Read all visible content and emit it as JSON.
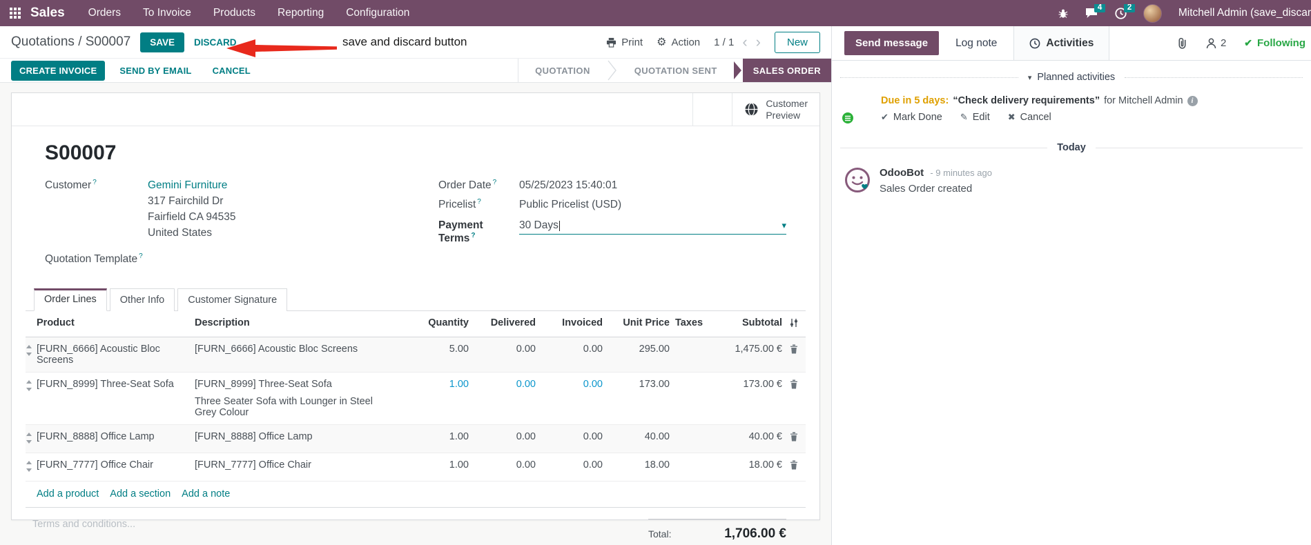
{
  "colors": {
    "navbar_purple": "#714B67",
    "primary_teal": "#017E84",
    "stage_active": "#714B67",
    "following_green": "#28a745",
    "annotation_red": "#e8291c",
    "edited_value_blue": "#0b96cc",
    "due_orange": "#dfa000",
    "badge_teal": "#0b8e93"
  },
  "icons": {
    "nav_left": "apps-grid",
    "nav_right": [
      "bug",
      "chat-bubble",
      "clock"
    ],
    "control_panel": [
      "printer",
      "gear",
      "chevron-left",
      "chevron-right"
    ],
    "sheet": [
      "globe",
      "drag-handle",
      "trash",
      "column-sliders",
      "dropdown-caret"
    ],
    "chatter": [
      "clock",
      "paperclip",
      "person",
      "check",
      "pencil",
      "x-mark",
      "info"
    ]
  },
  "nav": {
    "app_name": "Sales",
    "menus": [
      "Orders",
      "To Invoice",
      "Products",
      "Reporting",
      "Configuration"
    ],
    "message_badge": "4",
    "activity_badge": "2",
    "user_name": "Mitchell Admin (save_discar"
  },
  "control_panel": {
    "breadcrumb_parent": "Quotations",
    "breadcrumb_separator": "/",
    "breadcrumb_current": "S00007",
    "save_label": "SAVE",
    "discard_label": "DISCARD",
    "annotation_text": "save and discard button",
    "print_label": "Print",
    "action_label": "Action",
    "gear_glyph": "⚙",
    "pager": "1 / 1",
    "prev_glyph": "‹",
    "next_glyph": "›",
    "new_label": "New"
  },
  "statusbar": {
    "create_invoice": "CREATE INVOICE",
    "send_by_email": "SEND BY EMAIL",
    "cancel": "CANCEL",
    "stages": [
      {
        "label": "QUOTATION",
        "active": false
      },
      {
        "label": "QUOTATION SENT",
        "active": false
      },
      {
        "label": "SALES ORDER",
        "active": true
      }
    ]
  },
  "form": {
    "preview_line1": "Customer",
    "preview_line2": "Preview",
    "title": "S00007",
    "help_marker": "?",
    "customer": {
      "label": "Customer",
      "name": "Gemini Furniture",
      "address1": "317 Fairchild Dr",
      "address2": "Fairfield CA 94535",
      "address3": "United States"
    },
    "quotation_template_label": "Quotation Template",
    "order_date": {
      "label": "Order Date",
      "value": "05/25/2023 15:40:01"
    },
    "pricelist": {
      "label": "Pricelist",
      "value": "Public Pricelist (USD)"
    },
    "payment_terms": {
      "label": "Payment Terms",
      "value": "30 Days",
      "caret": "▾"
    },
    "tabs": [
      {
        "label": "Order Lines",
        "active": true
      },
      {
        "label": "Other Info",
        "active": false
      },
      {
        "label": "Customer Signature",
        "active": false
      }
    ],
    "order_lines": {
      "columns": [
        "Product",
        "Description",
        "Quantity",
        "Delivered",
        "Invoiced",
        "Unit Price",
        "Taxes",
        "Subtotal"
      ],
      "rows": [
        {
          "product": "[FURN_6666] Acoustic Bloc Screens",
          "description": "[FURN_6666] Acoustic Bloc Screens",
          "description_note": "",
          "quantity": "5.00",
          "delivered": "0.00",
          "invoiced": "0.00",
          "unit_price": "295.00",
          "taxes": "",
          "subtotal": "1,475.00 €"
        },
        {
          "product": "[FURN_8999] Three-Seat Sofa",
          "description": "[FURN_8999] Three-Seat Sofa",
          "description_note": "Three Seater Sofa with Lounger in Steel Grey Colour",
          "quantity": "1.00",
          "delivered": "0.00",
          "invoiced": "0.00",
          "unit_price": "173.00",
          "taxes": "",
          "subtotal": "173.00 €"
        },
        {
          "product": "[FURN_8888] Office Lamp",
          "description": "[FURN_8888] Office Lamp",
          "description_note": "",
          "quantity": "1.00",
          "delivered": "0.00",
          "invoiced": "0.00",
          "unit_price": "40.00",
          "taxes": "",
          "subtotal": "40.00 €"
        },
        {
          "product": "[FURN_7777] Office Chair",
          "description": "[FURN_7777] Office Chair",
          "description_note": "",
          "quantity": "1.00",
          "delivered": "0.00",
          "invoiced": "0.00",
          "unit_price": "18.00",
          "taxes": "",
          "subtotal": "18.00 €"
        }
      ],
      "add_product": "Add a product",
      "add_section": "Add a section",
      "add_note": "Add a note"
    },
    "terms_placeholder": "Terms and conditions...",
    "total_label": "Total:",
    "total_value": "1,706.00 €"
  },
  "chatter": {
    "send_message": "Send message",
    "log_note": "Log note",
    "activities": "Activities",
    "follower_count": "2",
    "following": "Following",
    "planned_section": "Planned activities",
    "activity": {
      "due": "Due in 5 days:",
      "summary": "“Check delivery requirements”",
      "assignee": "for Mitchell Admin",
      "mark_done": "Mark Done",
      "edit": "Edit",
      "cancel": "Cancel",
      "check_glyph": "✔",
      "pencil_glyph": "✎",
      "x_glyph": "✖"
    },
    "today": "Today",
    "message": {
      "author": "OdooBot",
      "time": "- 9 minutes ago",
      "body": "Sales Order created"
    }
  }
}
